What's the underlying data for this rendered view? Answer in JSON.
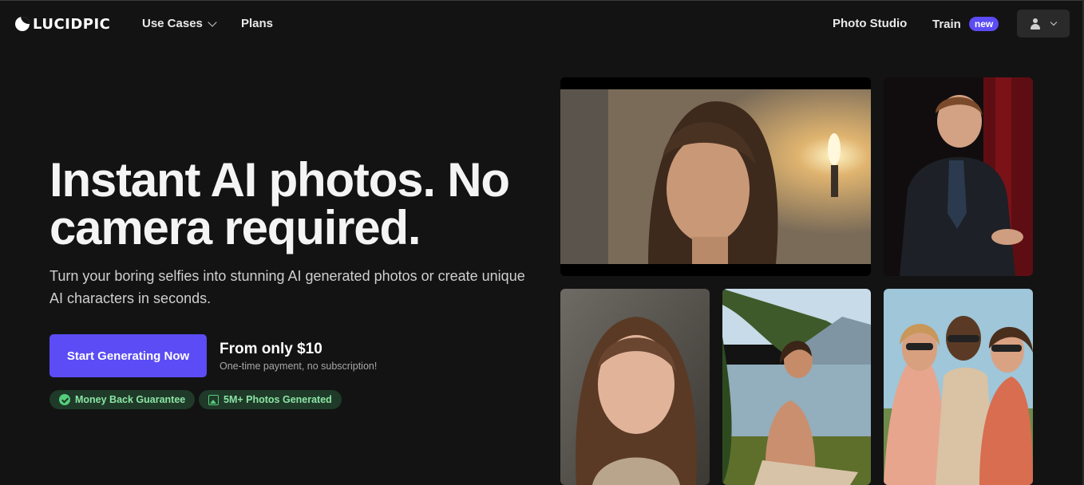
{
  "nav": {
    "logo_text": "LUCIDPIC",
    "use_cases": "Use Cases",
    "plans": "Plans",
    "photo_studio": "Photo Studio",
    "train": "Train",
    "train_badge": "new"
  },
  "hero": {
    "headline": "Instant AI photos. No camera required.",
    "subtext": "Turn your boring selfies into stunning AI generated photos or create unique AI characters in seconds.",
    "cta": "Start Generating Now",
    "price_main": "From only $10",
    "price_sub": "One-time payment, no subscription!",
    "badges": [
      {
        "label": "Money Back Guarantee",
        "icon": "check-circle-icon"
      },
      {
        "label": "5M+ Photos Generated",
        "icon": "images-icon"
      }
    ]
  },
  "gallery": [
    {
      "name": "woman-lamp-photo"
    },
    {
      "name": "man-speaker-photo"
    },
    {
      "name": "girl-portrait-photo"
    },
    {
      "name": "woman-lake-meditation-photo"
    },
    {
      "name": "friends-group-photo"
    }
  ],
  "colors": {
    "background": "#131313",
    "accent": "#5b4cf5",
    "badge_bg": "#1f3a28",
    "badge_text": "#8be3a4"
  }
}
